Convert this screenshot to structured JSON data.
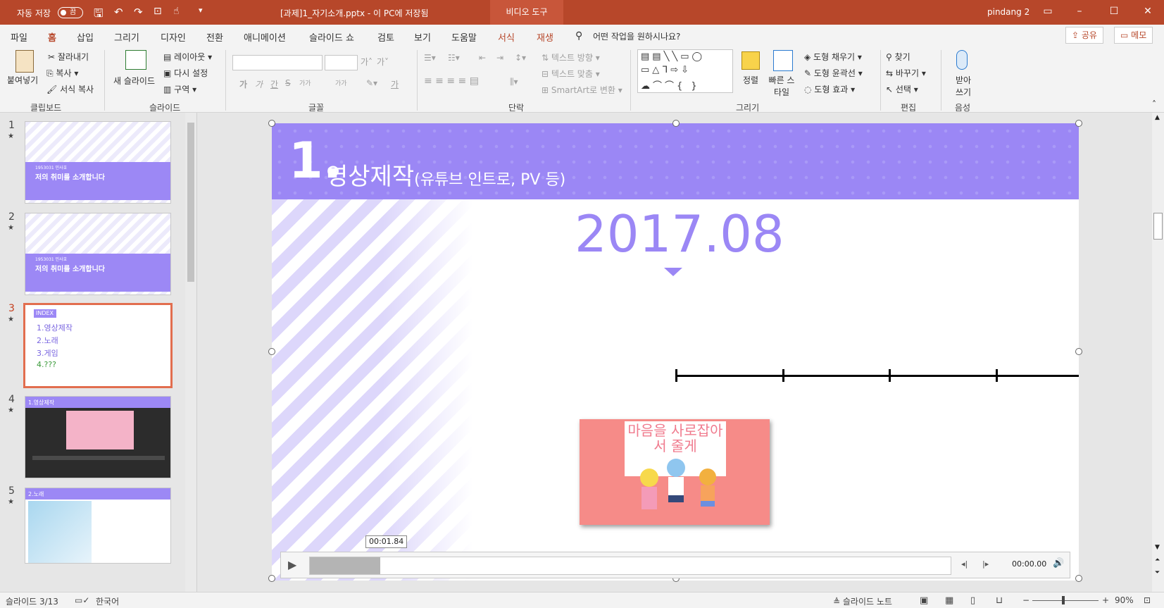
{
  "titlebar": {
    "autosave_label": "자동 저장",
    "autosave_state": "끔",
    "doc_title": "[과제]1_자기소개.pptx - 이 PC에 저장됨",
    "context_tab": "비디오 도구",
    "user": "pindang 2"
  },
  "tabs": {
    "file": "파일",
    "home": "홈",
    "insert": "삽입",
    "draw": "그리기",
    "design": "디자인",
    "transitions": "전환",
    "animations": "애니메이션",
    "slideshow": "슬라이드 쇼",
    "review": "검토",
    "view": "보기",
    "help": "도움말",
    "format": "서식",
    "playback": "재생",
    "search": "어떤 작업을 원하시나요?",
    "share": "공유",
    "comments": "메모"
  },
  "ribbon": {
    "clipboard": {
      "paste": "붙여넣기",
      "cut": "잘라내기",
      "copy": "복사",
      "format_painter": "서식 복사",
      "label": "클립보드"
    },
    "slides": {
      "new_slide": "새 슬라이드",
      "layout": "레이아웃",
      "reset": "다시 설정",
      "section": "구역",
      "label": "슬라이드"
    },
    "font": {
      "label": "글꼴",
      "grow": "가",
      "shrink": "가",
      "bold": "가",
      "italic": "가",
      "underline": "간",
      "strike": "S",
      "spacing": "가가",
      "case": "가가",
      "clear": "가"
    },
    "paragraph": {
      "text_direction": "텍스트 방향",
      "align_text": "텍스트 맞춤",
      "smartart": "SmartArt로 변환",
      "label": "단락"
    },
    "drawing": {
      "arrange": "정렬",
      "quick_styles": "빠른 스타일",
      "fill": "도형 채우기",
      "outline": "도형 윤곽선",
      "effects": "도형 효과",
      "label": "그리기"
    },
    "editing": {
      "find": "찾기",
      "replace": "바꾸기",
      "select": "선택",
      "label": "편집"
    },
    "voice": {
      "dictate": "받아 쓰기",
      "label": "음성"
    }
  },
  "slides_panel": [
    {
      "num": "1",
      "sub": "1953031 민사호",
      "title": "저의 취미를 소개합니다",
      "star": "★"
    },
    {
      "num": "2",
      "sub": "1953031 민사호",
      "title": "저의 취미를 소개합니다",
      "star": "★"
    },
    {
      "num": "3",
      "index": "INDEX",
      "items": [
        "1.영상제작",
        "2.노래",
        "3.게임",
        "4.???"
      ],
      "star": "★"
    },
    {
      "num": "4",
      "title": "1.영상제작",
      "star": "★"
    },
    {
      "num": "5",
      "title": "2.노래",
      "star": "★"
    }
  ],
  "slide": {
    "number": "1.",
    "title": "영상제작",
    "title_sub": "(유튜브 인트로, PV 등)",
    "date": "2017.08",
    "video_text": "마음을 사로잡아서 줄게"
  },
  "media": {
    "tooltip": "00:01.84",
    "time": "00:00.00",
    "progress": 0.11
  },
  "status": {
    "slide_info": "슬라이드 3/13",
    "language": "한국어",
    "notes": "슬라이드 노트",
    "zoom": "90%"
  },
  "colors": {
    "accent": "#b7472a",
    "slide_purple": "#9b87f5",
    "video_pink": "#f68b88"
  }
}
